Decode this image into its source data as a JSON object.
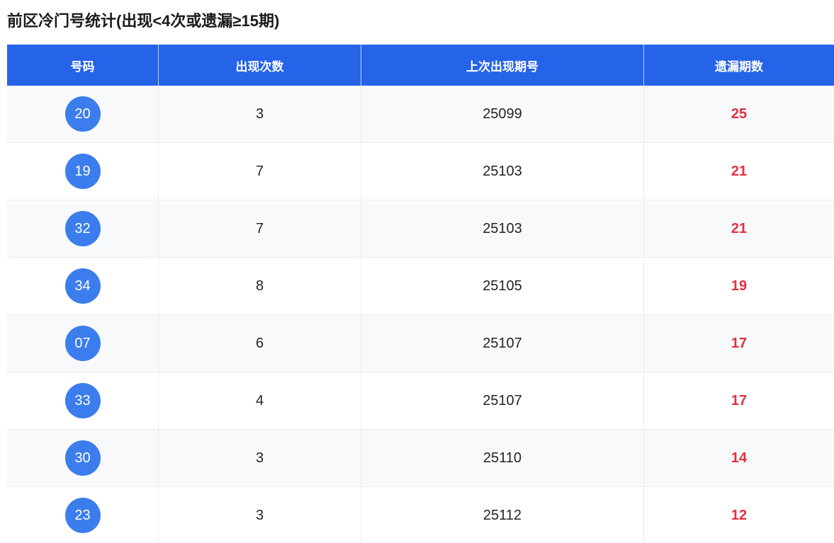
{
  "page": {
    "title": "前区冷门号统计(出现<4次或遗漏≥15期)"
  },
  "table": {
    "headers": [
      "号码",
      "出现次数",
      "上次出现期号",
      "遗漏期数"
    ],
    "rows": [
      {
        "number": "20",
        "count": "3",
        "last_period": "25099",
        "missing": "25"
      },
      {
        "number": "19",
        "count": "7",
        "last_period": "25103",
        "missing": "21"
      },
      {
        "number": "32",
        "count": "7",
        "last_period": "25103",
        "missing": "21"
      },
      {
        "number": "34",
        "count": "8",
        "last_period": "25105",
        "missing": "19"
      },
      {
        "number": "07",
        "count": "6",
        "last_period": "25107",
        "missing": "17"
      },
      {
        "number": "33",
        "count": "4",
        "last_period": "25107",
        "missing": "17"
      },
      {
        "number": "30",
        "count": "3",
        "last_period": "25110",
        "missing": "14"
      },
      {
        "number": "23",
        "count": "3",
        "last_period": "25112",
        "missing": "12"
      }
    ]
  },
  "colors": {
    "header_bg": "#2563e8",
    "badge_bg": "#3b7ded",
    "missing_text": "#e0313f",
    "stripe_bg": "#f8f9fa",
    "border": "#e9ecef",
    "body_text": "#212529"
  },
  "chart_data": {
    "type": "table",
    "title": "前区冷门号统计(出现<4次或遗漏≥15期)",
    "columns": [
      "号码",
      "出现次数",
      "上次出现期号",
      "遗漏期数"
    ],
    "rows": [
      [
        "20",
        3,
        25099,
        25
      ],
      [
        "19",
        7,
        25103,
        21
      ],
      [
        "32",
        7,
        25103,
        21
      ],
      [
        "34",
        8,
        25105,
        19
      ],
      [
        "07",
        6,
        25107,
        17
      ],
      [
        "33",
        4,
        25107,
        17
      ],
      [
        "30",
        3,
        25110,
        14
      ],
      [
        "23",
        3,
        25112,
        12
      ]
    ]
  }
}
